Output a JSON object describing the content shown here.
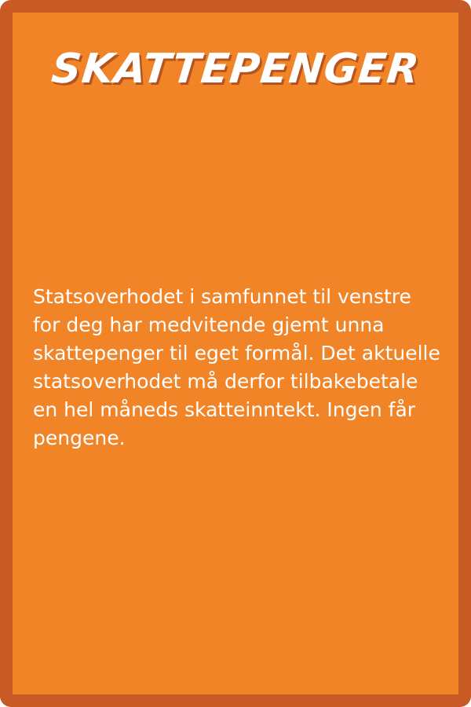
{
  "card": {
    "title": "SKATTEPENGER",
    "body": "Statsoverhodet i samfunnet til venstre for deg har medvitende gjemt unna skattepenger til eget formål. Det aktuelle statsoverhodet må derfor tilbakebetale en hel måneds skatteinntekt. Ingen får pengene."
  },
  "colors": {
    "border": "#c85a26",
    "background": "#f28428",
    "text": "#ffffff"
  }
}
